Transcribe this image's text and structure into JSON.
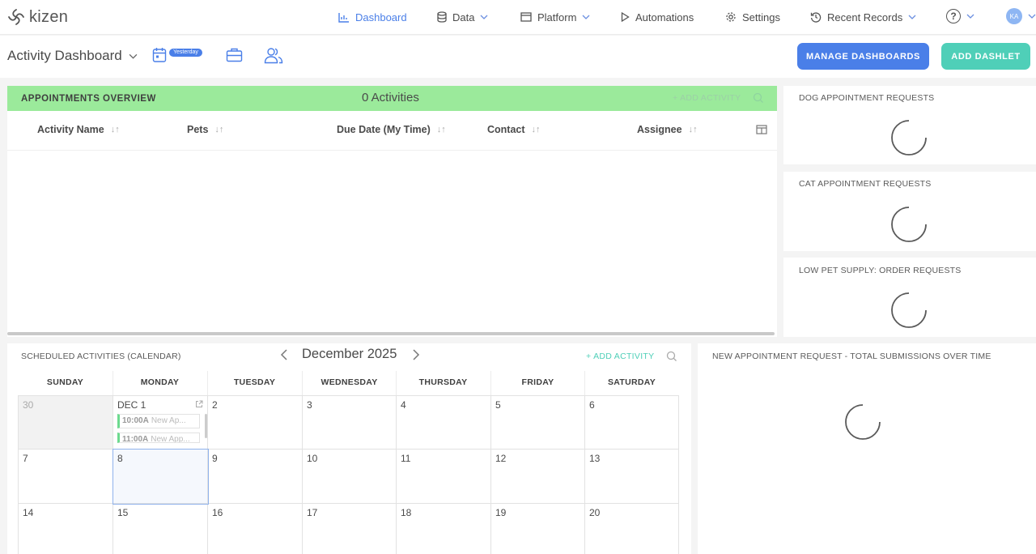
{
  "brand": {
    "name": "kizen"
  },
  "nav": {
    "dashboard": "Dashboard",
    "data": "Data",
    "platform": "Platform",
    "automations": "Automations",
    "settings": "Settings",
    "recent_records": "Recent Records",
    "help": "?",
    "avatar_initials": "KA"
  },
  "header": {
    "title": "Activity Dashboard",
    "date_badge": "Yesterday",
    "manage_button": "MANAGE DASHBOARDS",
    "add_button": "ADD DASHLET"
  },
  "appointments": {
    "title": "APPOINTMENTS OVERVIEW",
    "count": "0 Activities",
    "add_activity": "+ ADD ACTIVITY",
    "columns": [
      "Activity Name",
      "Pets",
      "Due Date (My Time)",
      "Contact",
      "Assignee"
    ]
  },
  "side_dashlets": {
    "dog": "DOG APPOINTMENT REQUESTS",
    "cat": "CAT APPOINTMENT REQUESTS",
    "low_supply": "LOW PET SUPPLY: ORDER REQUESTS",
    "new_requests": "NEW APPOINTMENT REQUEST - TOTAL SUBMISSIONS OVER TIME"
  },
  "calendar": {
    "title": "SCHEDULED ACTIVITIES (CALENDAR)",
    "month": "December 2025",
    "add_activity": "+ ADD ACTIVITY",
    "days": [
      "SUNDAY",
      "MONDAY",
      "TUESDAY",
      "WEDNESDAY",
      "THURSDAY",
      "FRIDAY",
      "SATURDAY"
    ],
    "weeks": [
      [
        "30",
        "DEC 1",
        "2",
        "3",
        "4",
        "5",
        "6"
      ],
      [
        "7",
        "8",
        "9",
        "10",
        "11",
        "12",
        "13"
      ],
      [
        "14",
        "15",
        "16",
        "17",
        "18",
        "19",
        "20"
      ]
    ],
    "events": [
      {
        "time": "10:00A",
        "title": "New Ap..."
      },
      {
        "time": "11:00A",
        "title": "New App..."
      }
    ]
  },
  "colors": {
    "accent_blue": "#4a7fe8",
    "teal": "#4fcfb8",
    "appt_header_green": "#9bea9b"
  }
}
